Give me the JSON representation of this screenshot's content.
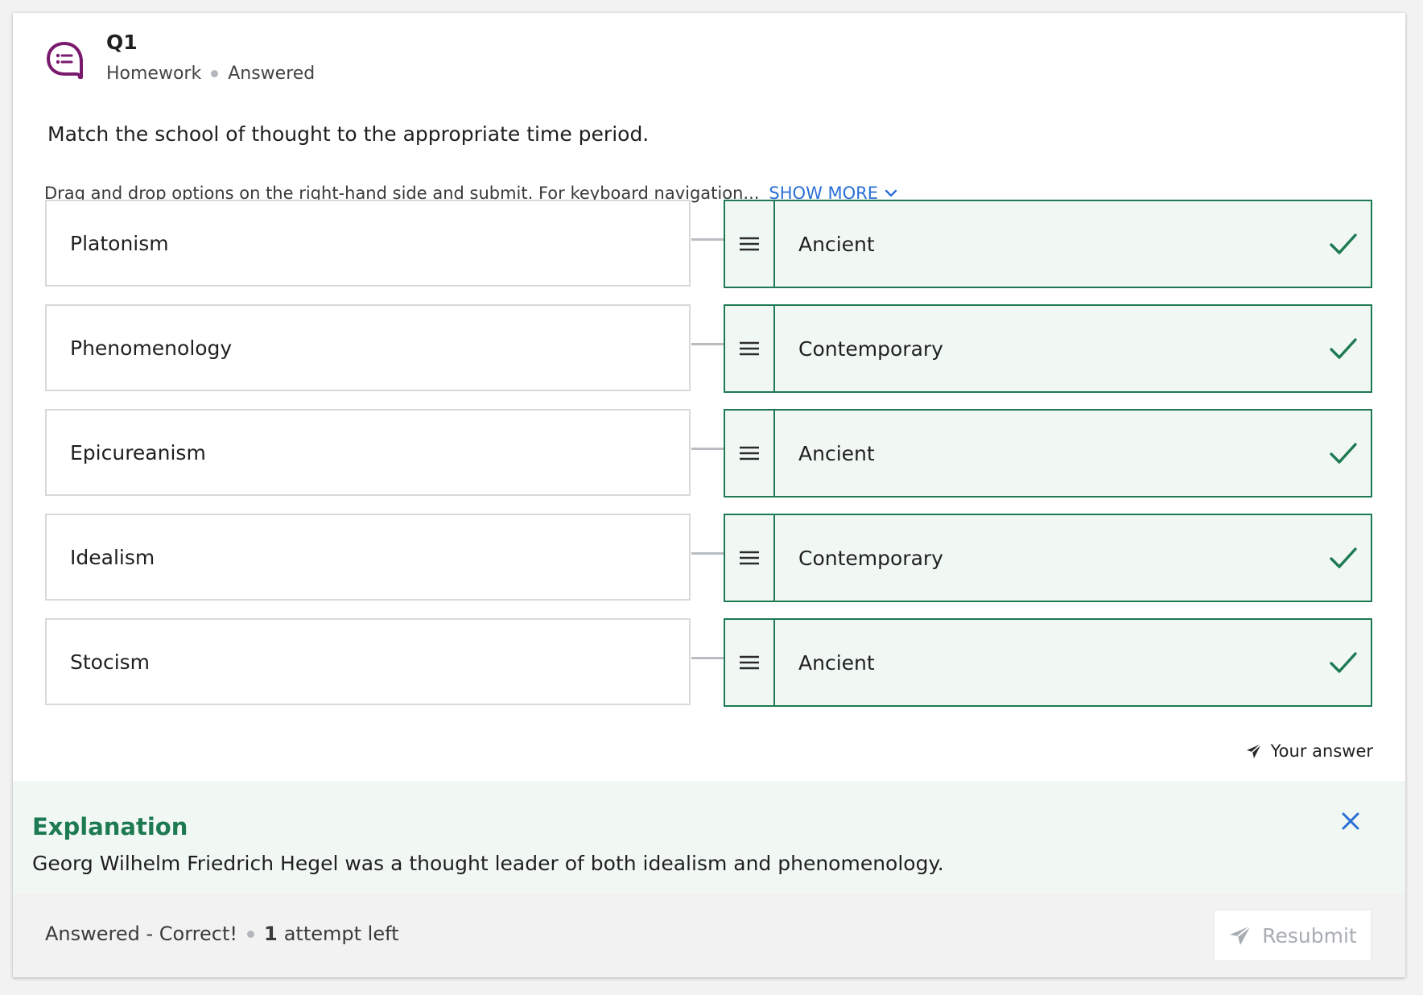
{
  "question": {
    "number": "Q1",
    "type": "Homework",
    "status": "Answered",
    "prompt": "Match the school of thought to the appropriate time period.",
    "instructions": "Drag and drop options on the right-hand side and submit. For keyboard navigation...",
    "show_more_label": "SHOW MORE"
  },
  "matches": [
    {
      "term": "Platonism",
      "answer": "Ancient",
      "correct": true
    },
    {
      "term": "Phenomenology",
      "answer": "Contemporary",
      "correct": true
    },
    {
      "term": "Epicureanism",
      "answer": "Ancient",
      "correct": true
    },
    {
      "term": "Idealism",
      "answer": "Contemporary",
      "correct": true
    },
    {
      "term": "Stocism",
      "answer": "Ancient",
      "correct": true
    }
  ],
  "your_answer_label": "Your answer",
  "explanation": {
    "title": "Explanation",
    "text": "Georg Wilhelm Friedrich Hegel was a thought leader of both idealism and phenomenology."
  },
  "footer": {
    "status": "Answered - Correct!",
    "attempts_count": "1",
    "attempts_label": "attempt left",
    "resubmit_label": "Resubmit"
  },
  "colors": {
    "correct_green": "#1e7a52",
    "link_blue": "#2a6fd6",
    "icon_purple": "#7a1a6e"
  }
}
